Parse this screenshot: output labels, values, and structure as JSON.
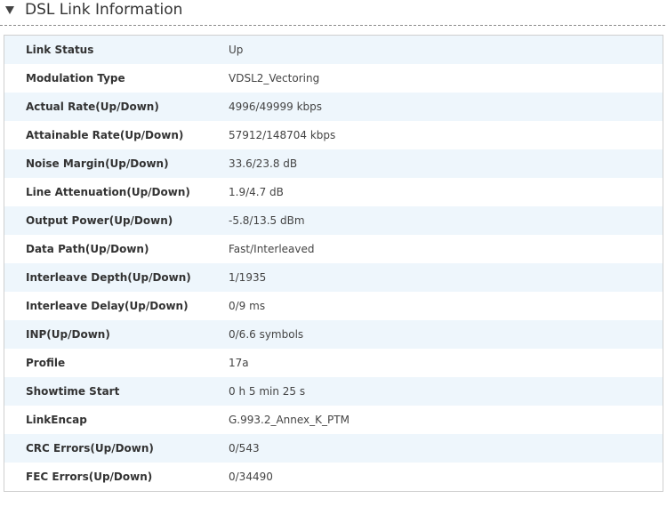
{
  "section": {
    "title": "DSL Link Information",
    "toggle_icon": "triangle-down-icon"
  },
  "rows": [
    {
      "label": "Link Status",
      "value": "Up"
    },
    {
      "label": "Modulation Type",
      "value": "VDSL2_Vectoring"
    },
    {
      "label": "Actual Rate(Up/Down)",
      "value": "4996/49999 kbps"
    },
    {
      "label": "Attainable Rate(Up/Down)",
      "value": "57912/148704 kbps"
    },
    {
      "label": "Noise Margin(Up/Down)",
      "value": "33.6/23.8 dB"
    },
    {
      "label": "Line Attenuation(Up/Down)",
      "value": "1.9/4.7 dB"
    },
    {
      "label": "Output Power(Up/Down)",
      "value": "-5.8/13.5 dBm"
    },
    {
      "label": "Data Path(Up/Down)",
      "value": "Fast/Interleaved"
    },
    {
      "label": "Interleave Depth(Up/Down)",
      "value": "1/1935"
    },
    {
      "label": "Interleave Delay(Up/Down)",
      "value": "0/9 ms"
    },
    {
      "label": "INP(Up/Down)",
      "value": "0/6.6 symbols"
    },
    {
      "label": "Profile",
      "value": "17a"
    },
    {
      "label": "Showtime Start",
      "value": "0 h 5 min 25 s"
    },
    {
      "label": "LinkEncap",
      "value": "G.993.2_Annex_K_PTM"
    },
    {
      "label": "CRC Errors(Up/Down)",
      "value": "0/543"
    },
    {
      "label": "FEC Errors(Up/Down)",
      "value": "0/34490"
    }
  ],
  "colors": {
    "row_alt_bg": "#eef6fc",
    "border": "#cfcfcf",
    "text": "#333333"
  }
}
